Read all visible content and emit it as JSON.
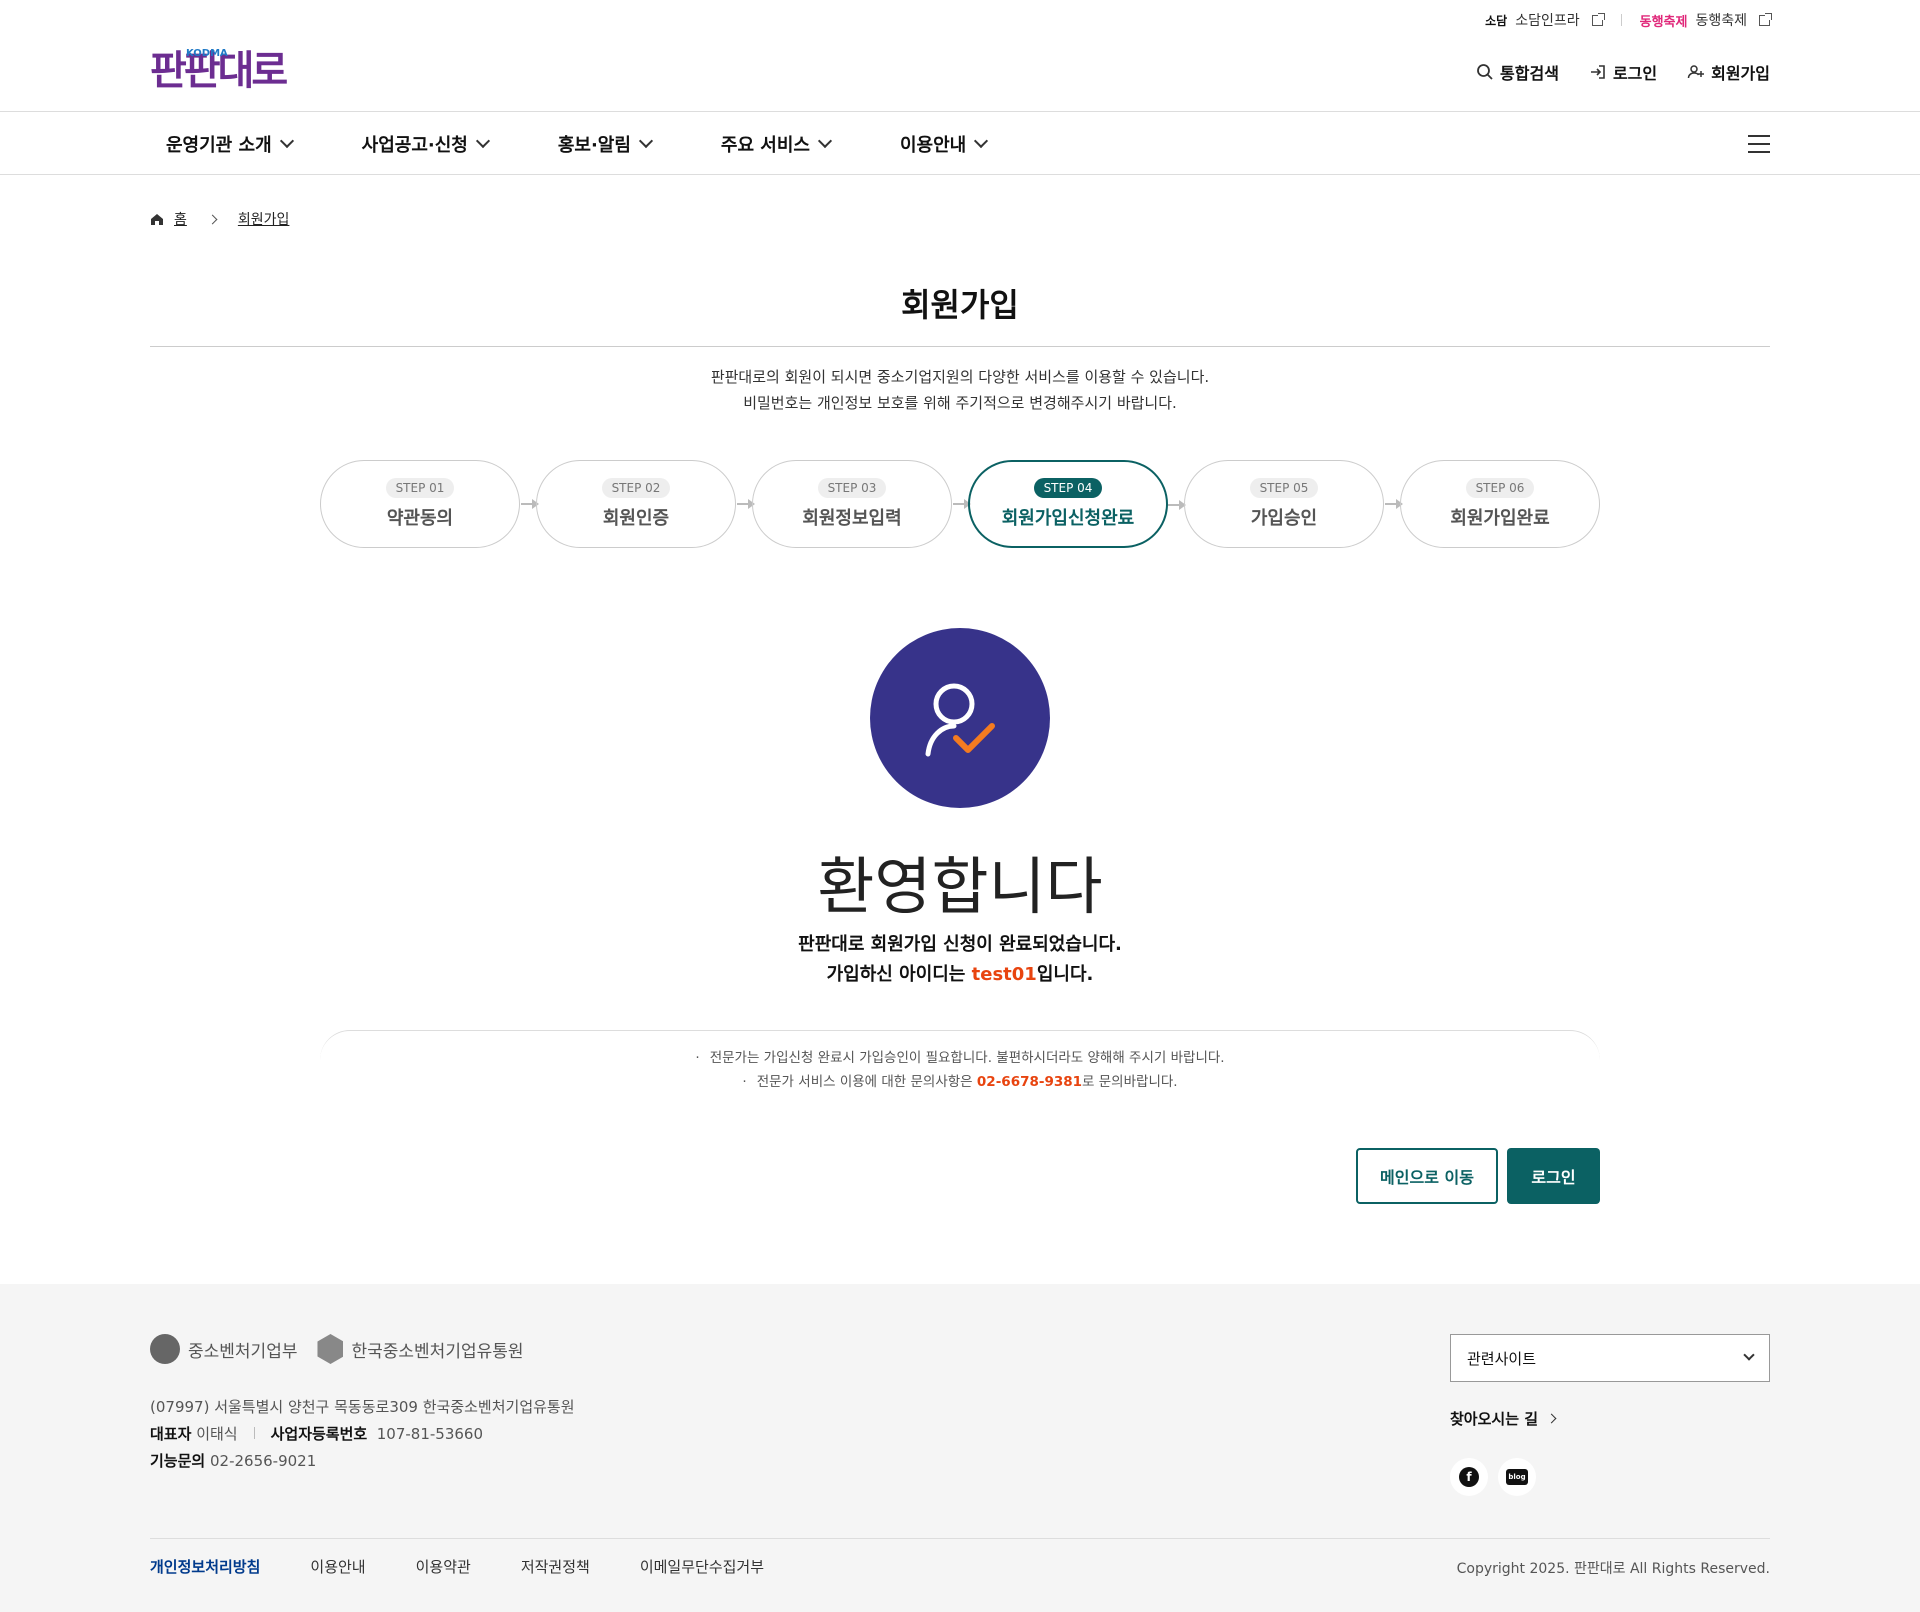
{
  "header": {
    "top_links": [
      {
        "logo": "소담",
        "label": "소담인프라"
      },
      {
        "logo": "동행축제",
        "label": "동행축제"
      }
    ],
    "logo_text": "판판대로",
    "logo_badge": "KODMA",
    "util": [
      {
        "icon": "search-icon",
        "label": "통합검색"
      },
      {
        "icon": "login-icon",
        "label": "로그인"
      },
      {
        "icon": "user-plus-icon",
        "label": "회원가입"
      }
    ]
  },
  "gnb": [
    "운영기관 소개",
    "사업공고·신청",
    "홍보·알림",
    "주요 서비스",
    "이용안내"
  ],
  "breadcrumb": {
    "home": "홈",
    "current": "회원가입"
  },
  "page": {
    "title": "회원가입",
    "intro_1": "판판대로의 회원이 되시면 중소기업지원의 다양한 서비스를 이용할 수 있습니다.",
    "intro_2": "비밀번호는 개인정보 보호를 위해 주기적으로 변경해주시기 바랍니다."
  },
  "steps": [
    {
      "no": "STEP 01",
      "label": "약관동의",
      "active": false
    },
    {
      "no": "STEP 02",
      "label": "회원인증",
      "active": false
    },
    {
      "no": "STEP 03",
      "label": "회원정보입력",
      "active": false
    },
    {
      "no": "STEP 04",
      "label": "회원가입신청완료",
      "active": true
    },
    {
      "no": "STEP 05",
      "label": "가입승인",
      "active": false
    },
    {
      "no": "STEP 06",
      "label": "회원가입완료",
      "active": false
    }
  ],
  "result": {
    "welcome": "환영합니다",
    "line1": "판판대로 회원가입 신청이 완료되었습니다.",
    "line2_pre": "가입하신 아이디는 ",
    "user_id": "test01",
    "line2_post": "입니다."
  },
  "notes": {
    "n1": "전문가는 가입신청 완료시 가입승인이 필요합니다. 불편하시더라도 양해해 주시기 바랍니다.",
    "n2_pre": "전문가 서비스 이용에 대한 문의사항은 ",
    "phone": "02-6678-9381",
    "n2_post": "로 문의바랍니다."
  },
  "buttons": {
    "main": "메인으로 이동",
    "login": "로그인"
  },
  "footer": {
    "org1": "중소벤처기업부",
    "org2": "한국중소벤처기업유통원",
    "address": "(07997) 서울특별시 양천구 목동동로309 한국중소벤처기업유통원",
    "rep_label": "대표자",
    "rep_name": "이태식",
    "biz_label": "사업자등록번호",
    "biz_no": "107-81-53660",
    "tel_label": "기능문의",
    "tel": "02-2656-9021",
    "related": "관련사이트",
    "directions": "찾아오시는 길",
    "links": [
      "개인정보처리방침",
      "이용안내",
      "이용약관",
      "저작권정책",
      "이메일무단수집거부"
    ],
    "copyright": "Copyright 2025. 판판대로 All Rights Reserved."
  },
  "colors": {
    "accent": "#0b6163",
    "highlight": "#e8440f",
    "avatar_bg": "#37338a",
    "logo": "#6c2d91"
  }
}
